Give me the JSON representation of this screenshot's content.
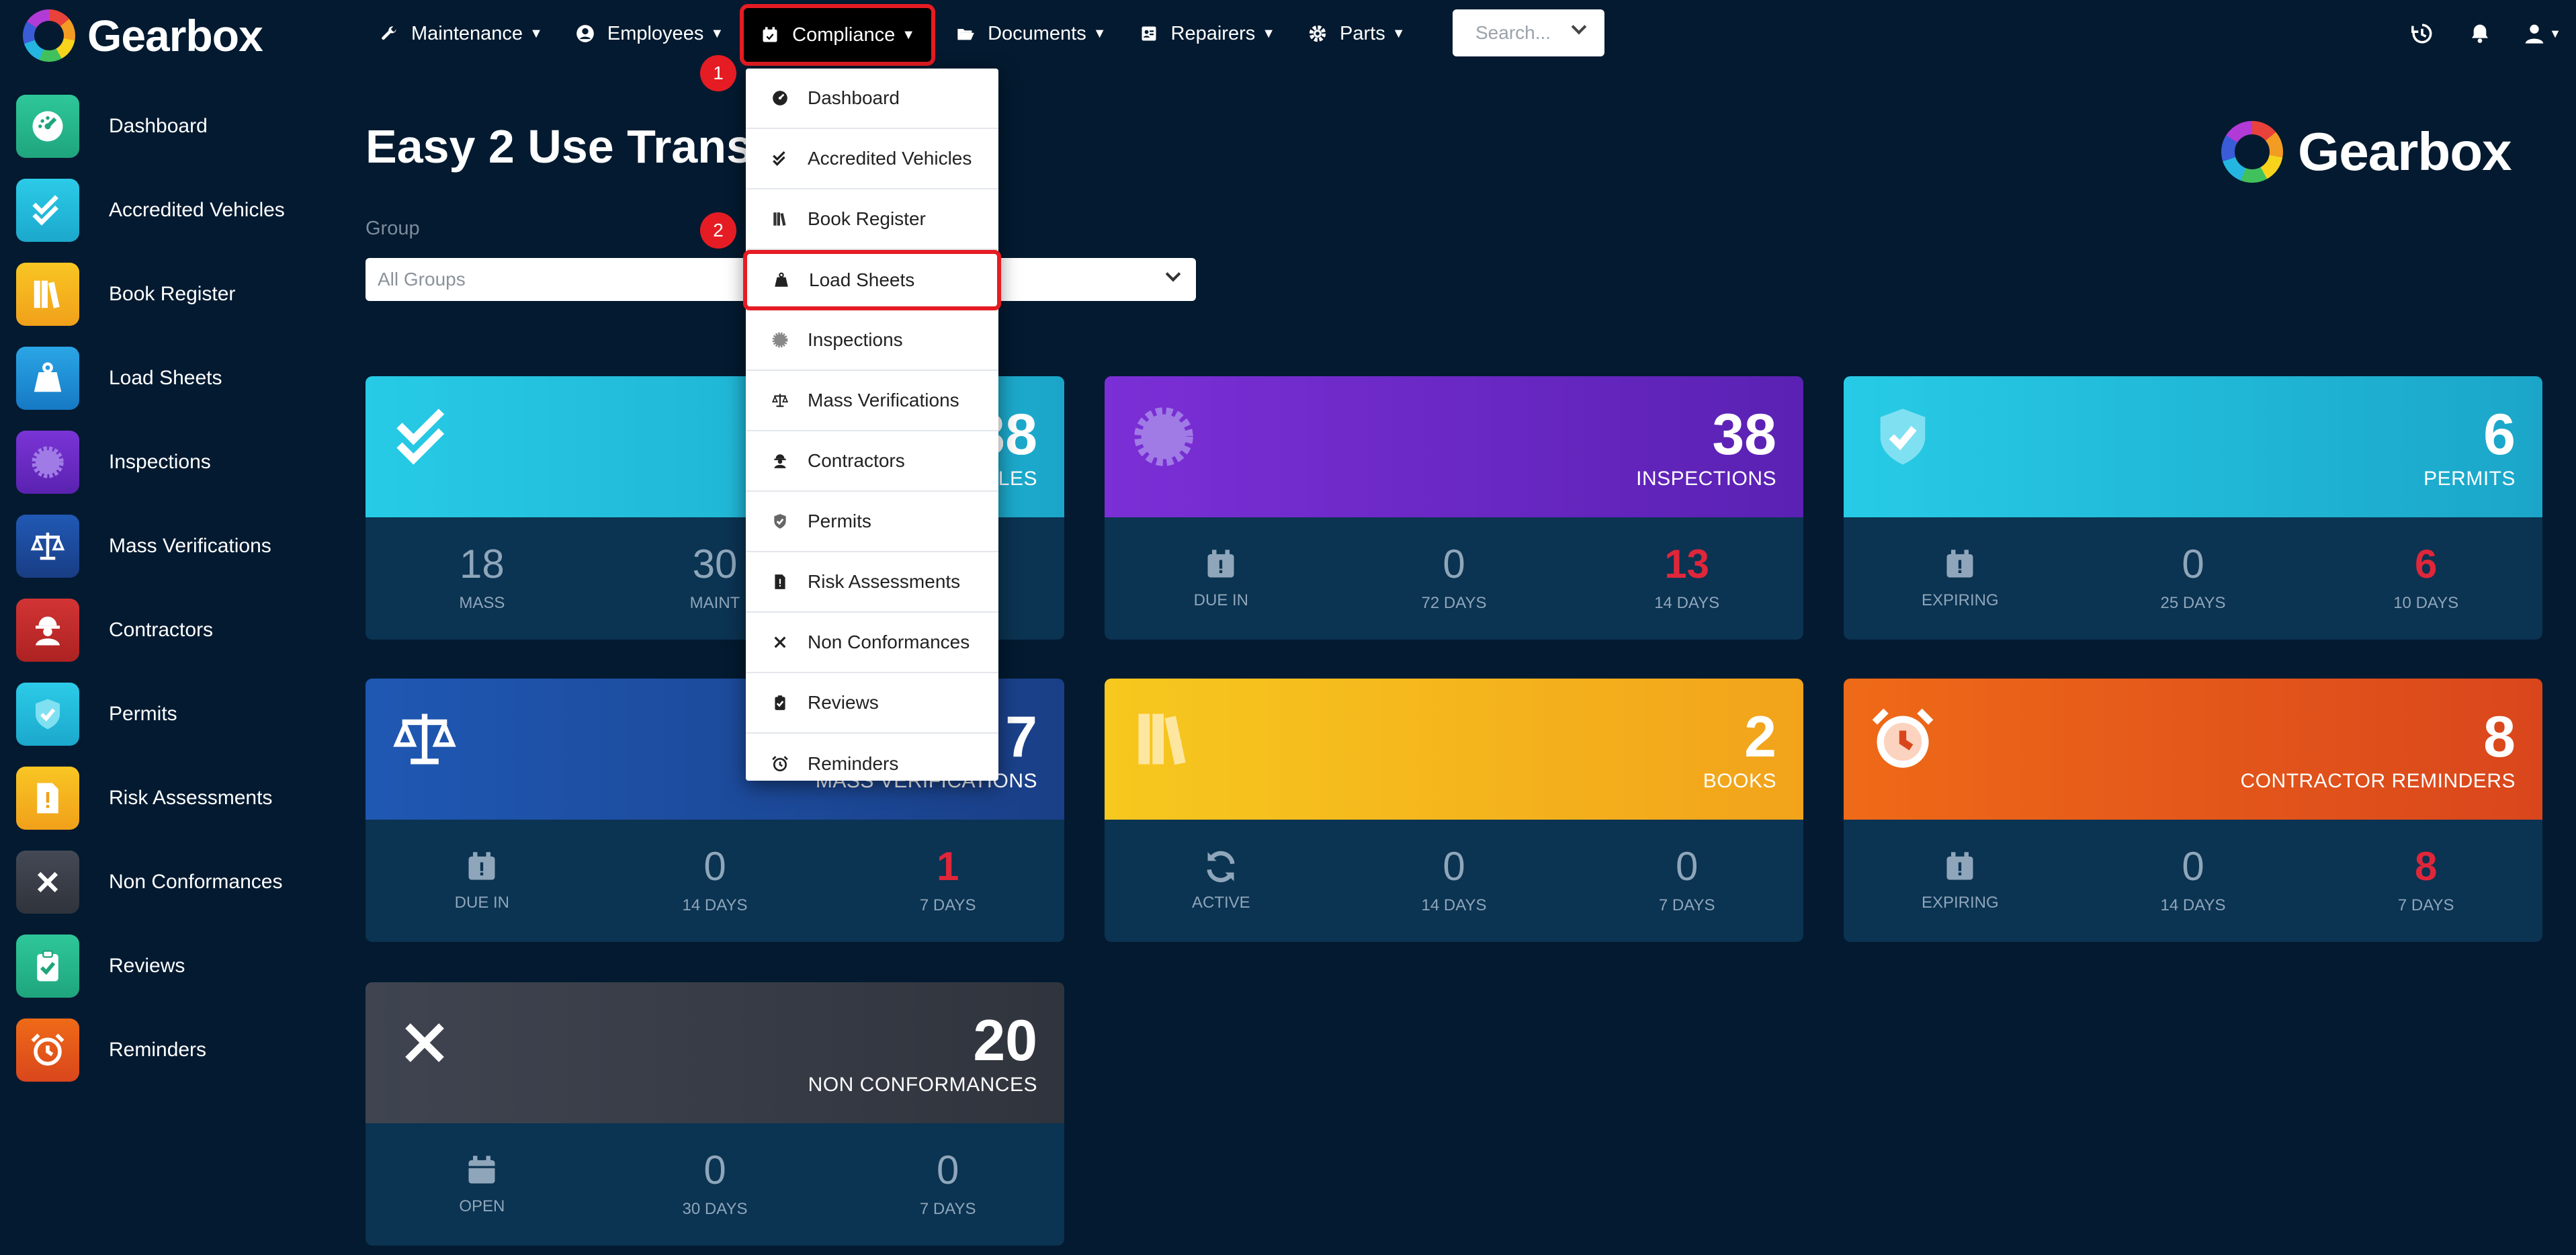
{
  "brand": {
    "name": "Gearbox"
  },
  "nav": {
    "items": [
      {
        "label": "Maintenance"
      },
      {
        "label": "Employees"
      },
      {
        "label": "Compliance"
      },
      {
        "label": "Documents"
      },
      {
        "label": "Repairers"
      },
      {
        "label": "Parts"
      }
    ],
    "search_placeholder": "Search..."
  },
  "sidebar": {
    "items": [
      {
        "label": "Dashboard",
        "color": "#26b58a"
      },
      {
        "label": "Accredited Vehicles",
        "color": "#22b8d6"
      },
      {
        "label": "Book Register",
        "color": "#f5b41c"
      },
      {
        "label": "Load Sheets",
        "color": "#1e8fd6"
      },
      {
        "label": "Inspections",
        "color": "#6b2fc2"
      },
      {
        "label": "Mass Verifications",
        "color": "#1d4a8f"
      },
      {
        "label": "Contractors",
        "color": "#c42a2a"
      },
      {
        "label": "Permits",
        "color": "#22b8d6"
      },
      {
        "label": "Risk Assessments",
        "color": "#f5b41c"
      },
      {
        "label": "Non Conformances",
        "color": "#3b3f48"
      },
      {
        "label": "Reviews",
        "color": "#26b58a"
      },
      {
        "label": "Reminders",
        "color": "#e3571f"
      }
    ]
  },
  "main": {
    "title": "Easy 2 Use Trans",
    "group_label": "Group",
    "group_value": "All Groups"
  },
  "cards": [
    {
      "value": "38",
      "label": "LES",
      "gradient": [
        "#27cbe6",
        "#1ba6c9"
      ],
      "stats": [
        {
          "v": "18",
          "l": "MASS"
        },
        {
          "v": "30",
          "l": "MAINT"
        }
      ]
    },
    {
      "value": "38",
      "label": "INSPECTIONS",
      "gradient": [
        "#7b2fd6",
        "#5a21b3"
      ],
      "stats": [
        {
          "v": "",
          "l": "DUE IN"
        },
        {
          "v": "0",
          "l": "72 DAYS"
        },
        {
          "v": "13",
          "l": "14 DAYS",
          "red": true
        }
      ]
    },
    {
      "value": "6",
      "label": "PERMITS",
      "gradient": [
        "#27cbe6",
        "#1ba6c9"
      ],
      "stats": [
        {
          "v": "",
          "l": "EXPIRING"
        },
        {
          "v": "0",
          "l": "25 DAYS"
        },
        {
          "v": "6",
          "l": "10 DAYS",
          "red": true
        }
      ]
    },
    {
      "value": "7",
      "label": "MASS VERIFICATIONS",
      "gradient": [
        "#1f58b3",
        "#1a3f87"
      ],
      "stats": [
        {
          "v": "",
          "l": "DUE IN"
        },
        {
          "v": "0",
          "l": "14 DAYS"
        },
        {
          "v": "1",
          "l": "7 DAYS",
          "red": true
        }
      ]
    },
    {
      "value": "2",
      "label": "BOOKS",
      "gradient": [
        "#f7c81e",
        "#f2a31b"
      ],
      "stats": [
        {
          "v": "",
          "l": "ACTIVE"
        },
        {
          "v": "0",
          "l": "14 DAYS"
        },
        {
          "v": "0",
          "l": "7 DAYS"
        }
      ]
    },
    {
      "value": "8",
      "label": "CONTRACTOR REMINDERS",
      "gradient": [
        "#ef6a18",
        "#d9461c"
      ],
      "stats": [
        {
          "v": "",
          "l": "EXPIRING"
        },
        {
          "v": "0",
          "l": "14 DAYS"
        },
        {
          "v": "8",
          "l": "7 DAYS",
          "red": true
        }
      ]
    },
    {
      "value": "20",
      "label": "NON CONFORMANCES",
      "gradient": [
        "#3f4450",
        "#30343d"
      ],
      "stats": [
        {
          "v": "",
          "l": "OPEN"
        },
        {
          "v": "0",
          "l": "30 DAYS"
        },
        {
          "v": "0",
          "l": "7 DAYS"
        }
      ]
    }
  ],
  "dropdown": {
    "items": [
      {
        "label": "Dashboard"
      },
      {
        "label": "Accredited Vehicles"
      },
      {
        "label": "Book Register"
      },
      {
        "label": "Load Sheets"
      },
      {
        "label": "Inspections"
      },
      {
        "label": "Mass Verifications"
      },
      {
        "label": "Contractors"
      },
      {
        "label": "Permits"
      },
      {
        "label": "Risk Assessments"
      },
      {
        "label": "Non Conformances"
      },
      {
        "label": "Reviews"
      },
      {
        "label": "Reminders"
      }
    ]
  },
  "annotations": {
    "step1": "1",
    "step2": "2"
  }
}
